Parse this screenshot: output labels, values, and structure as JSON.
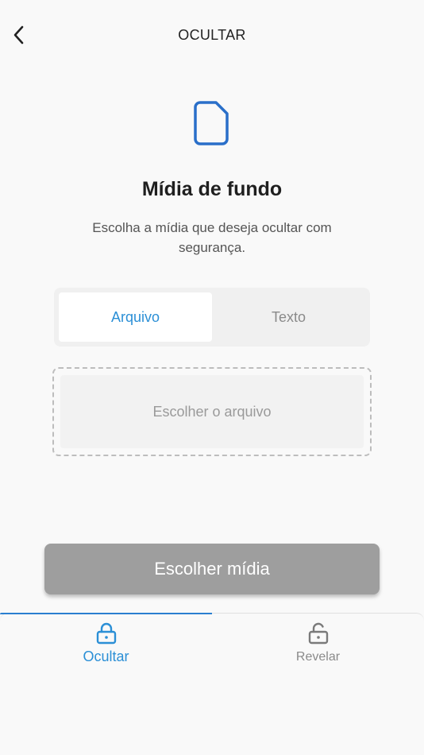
{
  "header": {
    "title": "OCULTAR"
  },
  "main": {
    "icon": "file-icon",
    "title": "Mídia de fundo",
    "description": "Escolha a mídia que deseja ocultar com segurança."
  },
  "segment": {
    "tabs": [
      {
        "label": "Arquivo",
        "active": true
      },
      {
        "label": "Texto",
        "active": false
      }
    ]
  },
  "dropzone": {
    "label": "Escolher o arquivo"
  },
  "primary_button": {
    "label": "Escolher mídia"
  },
  "bottom_nav": {
    "items": [
      {
        "label": "Ocultar",
        "icon": "lock-icon",
        "active": true
      },
      {
        "label": "Revelar",
        "icon": "unlock-icon",
        "active": false
      }
    ]
  },
  "colors": {
    "accent": "#2b8fd6",
    "icon_blue": "#2a6fc9",
    "button_disabled": "#9e9e9e",
    "background": "#f9f9f9"
  }
}
